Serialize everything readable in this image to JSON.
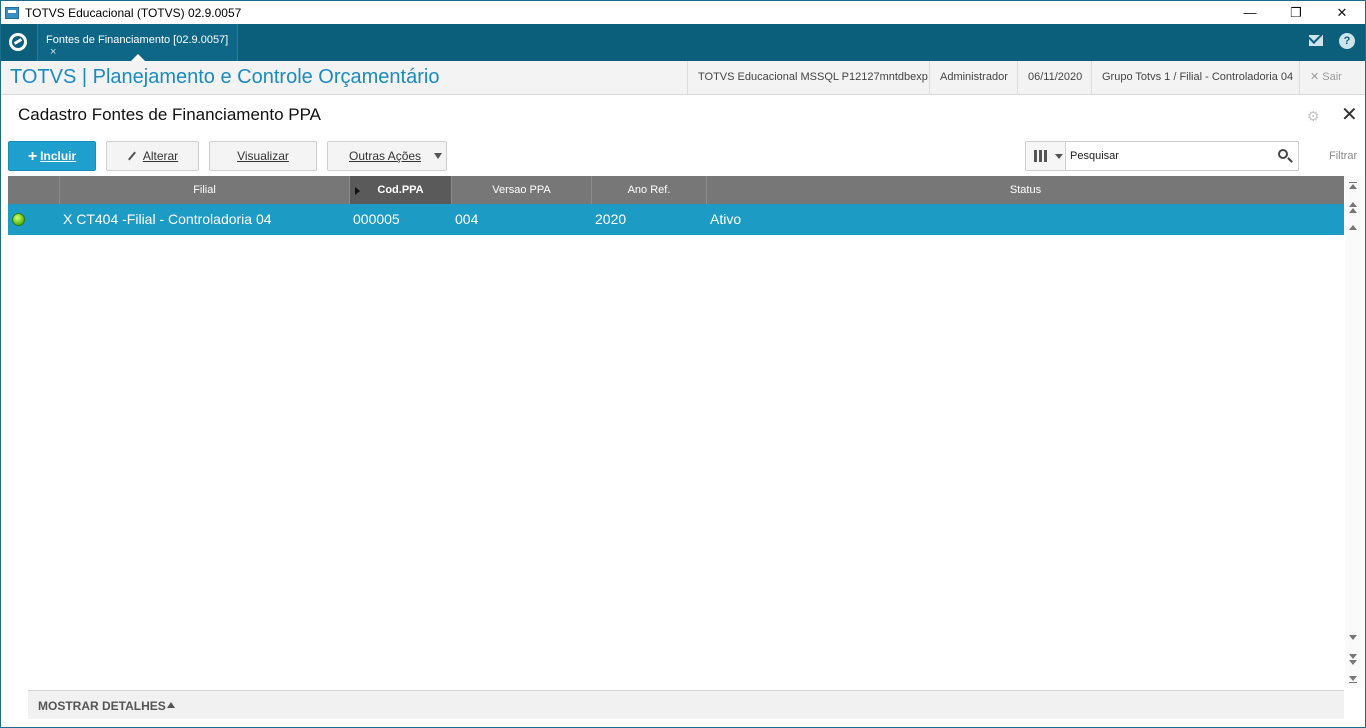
{
  "window": {
    "title": "TOTVS Educacional (TOTVS) 02.9.0057",
    "controls": {
      "minimize": "—",
      "restore": "❐",
      "close": "✕"
    }
  },
  "tabbar": {
    "tab_label": "Fontes de Financiamento [02.9.0057]",
    "tab_close": "×"
  },
  "header": {
    "app_title": "TOTVS | Planejamento e Controle Orçamentário",
    "connection": "TOTVS Educacional MSSQL P12127mntdbexp",
    "user": "Administrador",
    "date": "06/11/2020",
    "company": "Grupo Totvs 1 / Filial - Controladoria 04",
    "logout_icon": "✕",
    "logout_label": "Sair"
  },
  "page": {
    "title": "Cadastro Fontes de Financiamento PPA"
  },
  "toolbar": {
    "incluir": "Incluir",
    "alterar": "Alterar",
    "visualizar": "Visualizar",
    "outras_acoes": "Outras Ações",
    "search_placeholder": "Pesquisar",
    "filtrar": "Filtrar"
  },
  "grid": {
    "columns": [
      "",
      "Filial",
      "Cod.PPA",
      "Versao PPA",
      "Ano Ref.",
      "Status"
    ],
    "sorted_column": "Cod.PPA",
    "rows": [
      {
        "status_color": "#66c21a",
        "filial": "X CT404 -Filial - Controladoria 04",
        "cod_ppa": "000005",
        "versao_ppa": "004",
        "ano_ref": "2020",
        "status": "Ativo"
      }
    ]
  },
  "footer": {
    "details_label": "MOSTRAR DETALHES"
  },
  "colors": {
    "tabbar_bg": "#0b5f7b",
    "accent": "#1a8bbf",
    "selected_row": "#1c9bc5",
    "primary_button": "#1f9fcd",
    "grid_header": "#777777"
  },
  "icons": {
    "logo": "totvs-logo-icon",
    "mail": "mail-icon",
    "help": "help-icon",
    "settings": "gear-icon",
    "close": "close-icon",
    "search": "search-icon",
    "columns": "columns-icon"
  }
}
